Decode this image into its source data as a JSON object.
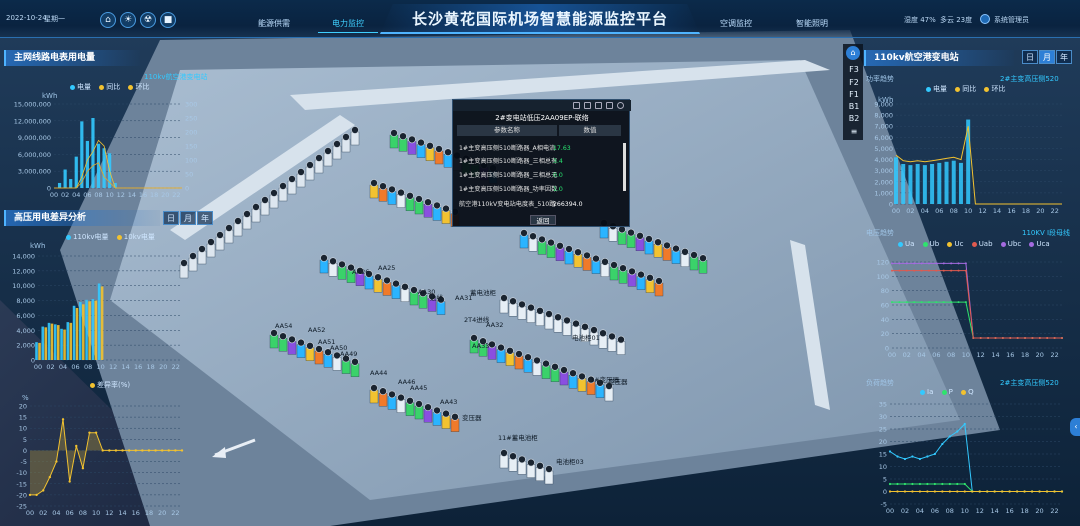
{
  "header": {
    "date": "2022-10-24",
    "weekday": "星期一",
    "title": "长沙黄花国际机场智慧能源监控平台",
    "nav_left": [
      "能源供需",
      "电力监控"
    ],
    "nav_right": [
      "空调监控",
      "智能照明"
    ],
    "weather": "湿度 47%",
    "temperature": "多云 23度",
    "user": "系统管理员",
    "icons": [
      "home-icon",
      "energy-icon",
      "hazard-icon",
      "camera-icon"
    ]
  },
  "left_panels": {
    "main_meter": {
      "title": "主网线路电表用电量",
      "station_label": "110kv航空港变电站",
      "legend": [
        "电量",
        "同比",
        "环比"
      ],
      "y_unit": "kWh",
      "y_left_ticks": [
        "15,000,000",
        "12,000,000",
        "9,000,000",
        "6,000,000",
        "3,000,000",
        "0"
      ],
      "y_right_ticks": [
        "300",
        "250",
        "200",
        "150",
        "100",
        "50",
        "0"
      ],
      "x_ticks": [
        "00",
        "02",
        "04",
        "06",
        "08",
        "10",
        "12",
        "14",
        "16",
        "18",
        "20",
        "22"
      ]
    },
    "hv_diff": {
      "title": "高压用电差异分析",
      "segments": [
        "日",
        "月",
        "年"
      ],
      "active_segment": 0,
      "legend": [
        "110kv电量",
        "10kv电量"
      ],
      "y_unit": "kWh",
      "y_ticks": [
        "14,000",
        "12,000",
        "10,000",
        "8,000",
        "6,000",
        "4,000",
        "2,000",
        "0"
      ],
      "x_ticks": [
        "00",
        "02",
        "04",
        "06",
        "08",
        "10",
        "12",
        "14",
        "16",
        "18",
        "20",
        "22"
      ]
    },
    "diff_rate": {
      "legend": "差异率(%)",
      "y_unit": "%",
      "y_ticks": [
        "20",
        "15",
        "10",
        "5",
        "0",
        "-5",
        "-10",
        "-15",
        "-20",
        "-25"
      ],
      "x_ticks": [
        "00",
        "02",
        "04",
        "06",
        "08",
        "10",
        "12",
        "14",
        "16",
        "18",
        "20",
        "22"
      ]
    }
  },
  "right_panels": {
    "station": {
      "title": "110kv航空港变电站",
      "segments": [
        "日",
        "月",
        "年"
      ],
      "active_segment": 1,
      "floors": [
        "F3",
        "F2",
        "F1",
        "B1",
        "B2"
      ],
      "power_trend": {
        "label": "功率趋势",
        "transformer": "2#主变高压侧520",
        "legend": [
          "电量",
          "同比",
          "环比"
        ],
        "y_unit": "kWh",
        "y_ticks": [
          "9,000",
          "8,000",
          "7,000",
          "6,000",
          "5,000",
          "4,000",
          "3,000",
          "2,000",
          "1,000",
          "0"
        ],
        "x_ticks": [
          "00",
          "02",
          "04",
          "06",
          "08",
          "10",
          "12",
          "14",
          "16",
          "18",
          "20",
          "22"
        ]
      },
      "voltage_trend": {
        "label": "电压趋势",
        "line": "110KV I段母线",
        "legend": [
          "Ua",
          "Ub",
          "Uc",
          "Uab",
          "Ubc",
          "Uca"
        ],
        "y_ticks": [
          "120",
          "100",
          "80",
          "60",
          "40",
          "20",
          "0"
        ],
        "x_ticks": [
          "00",
          "02",
          "04",
          "06",
          "08",
          "10",
          "12",
          "14",
          "16",
          "18",
          "20",
          "22"
        ]
      },
      "load_trend": {
        "label": "负荷趋势",
        "transformer": "2#主变高压侧520",
        "legend": [
          "Ia",
          "P",
          "Q"
        ],
        "y_ticks": [
          "35",
          "30",
          "25",
          "20",
          "15",
          "10",
          "5",
          "0",
          "-5"
        ],
        "x_ticks": [
          "00",
          "02",
          "04",
          "06",
          "08",
          "10",
          "12",
          "14",
          "16",
          "18",
          "20",
          "22"
        ]
      }
    }
  },
  "popup": {
    "title": "2#变电站低压2AA09EP-联络",
    "columns": [
      "参数名称",
      "数值"
    ],
    "rows": [
      {
        "name": "1#主变高压侧510断路器_A相电流",
        "value": "17.63"
      },
      {
        "name": "1#主变高压侧510断路器_三相总有",
        "value": "3.4"
      },
      {
        "name": "1#主变高压侧510断路器_三相总无",
        "value": "0.0"
      },
      {
        "name": "1#主变高压侧510断路器_功率因数",
        "value": "1.0"
      },
      {
        "name": "航空港110kV变电站电度表_510路",
        "value": "266394.0"
      }
    ],
    "back": "返回"
  },
  "scene_labels": [
    "AA31",
    "AA30",
    "AA25",
    "AA26",
    "AA54",
    "AA52",
    "AA51",
    "AA50",
    "AA49",
    "AA44",
    "AA46",
    "AA45",
    "AA43",
    "蓄电池柜",
    "2T4进线",
    "AA32",
    "1#变压器",
    "11#蓄电池柜",
    "电池柜03",
    "电池柜01",
    "AA33",
    "变压器",
    "变压器",
    "进线"
  ],
  "colors": {
    "accent": "#2d7fd6",
    "cyan": "#33c9ff",
    "yellow": "#f2c230",
    "green": "#2fe36d",
    "purple": "#a46be0"
  },
  "chart_data": [
    {
      "type": "bar",
      "title": "主网线路电表用电量",
      "ylabel": "kWh",
      "categories": [
        "00",
        "01",
        "02",
        "03",
        "04",
        "05",
        "06",
        "07",
        "08",
        "09",
        "10",
        "11",
        "12",
        "13",
        "14",
        "15",
        "16",
        "17",
        "18",
        "19",
        "20",
        "21",
        "22",
        "23"
      ],
      "series": [
        {
          "name": "电量",
          "values": [
            0,
            900000,
            3300000,
            1600000,
            5600000,
            11900000,
            8400000,
            12500000,
            7900000,
            7100000,
            6200000,
            900000,
            0,
            0,
            0,
            0,
            0,
            0,
            0,
            0,
            0,
            0,
            0,
            0
          ]
        },
        {
          "name": "同比",
          "values": [
            0,
            0,
            0,
            0,
            0,
            40,
            100,
            130,
            170,
            150,
            60,
            0,
            0,
            0,
            0,
            0,
            0,
            0,
            0,
            0,
            0,
            0,
            0,
            0
          ]
        },
        {
          "name": "环比",
          "values": [
            0,
            0,
            0,
            0,
            0,
            20,
            60,
            80,
            90,
            40,
            20,
            0,
            0,
            0,
            0,
            0,
            0,
            0,
            0,
            0,
            0,
            0,
            0,
            0
          ]
        }
      ],
      "ylim": [
        0,
        15000000
      ],
      "ylim_right": [
        0,
        300
      ]
    },
    {
      "type": "bar",
      "title": "高压用电差异分析",
      "ylabel": "kWh",
      "categories": [
        "00",
        "01",
        "02",
        "03",
        "04",
        "05",
        "06",
        "07",
        "08",
        "09",
        "10",
        "11",
        "12",
        "13",
        "14",
        "15",
        "16",
        "17",
        "18",
        "19",
        "20",
        "21",
        "22",
        "23"
      ],
      "series": [
        {
          "name": "110kv电量",
          "values": [
            2400,
            4500,
            5000,
            4800,
            4200,
            5100,
            7300,
            7800,
            8100,
            8200,
            10300,
            0,
            0,
            0,
            0,
            0,
            0,
            0,
            0,
            0,
            0,
            0,
            0,
            0
          ]
        },
        {
          "name": "10kv电量",
          "values": [
            2300,
            4400,
            4900,
            4700,
            4100,
            5000,
            7000,
            7500,
            7900,
            8000,
            9900,
            0,
            0,
            0,
            0,
            0,
            0,
            0,
            0,
            0,
            0,
            0,
            0,
            0
          ]
        }
      ],
      "ylim": [
        0,
        14000
      ]
    },
    {
      "type": "line",
      "title": "差异率(%)",
      "ylabel": "%",
      "x": [
        0,
        1,
        2,
        3,
        4,
        5,
        6,
        7,
        8,
        9,
        10,
        11,
        12,
        13,
        14,
        15,
        16,
        17,
        18,
        19,
        20,
        21,
        22,
        23
      ],
      "series": [
        {
          "name": "差异率(%)",
          "values": [
            -20,
            -20,
            -18,
            -12,
            -5,
            14,
            -14,
            2,
            -8,
            8,
            8,
            0,
            0,
            0,
            0,
            0,
            0,
            0,
            0,
            0,
            0,
            0,
            0,
            0
          ]
        }
      ],
      "ylim": [
        -25,
        20
      ]
    },
    {
      "type": "bar",
      "title": "功率趋势",
      "ylabel": "kWh",
      "categories": [
        "00",
        "01",
        "02",
        "03",
        "04",
        "05",
        "06",
        "07",
        "08",
        "09",
        "10",
        "11",
        "12",
        "13",
        "14",
        "15",
        "16",
        "17",
        "18",
        "19",
        "20",
        "21",
        "22",
        "23"
      ],
      "series": [
        {
          "name": "电量",
          "values": [
            4200,
            3600,
            3500,
            3600,
            3500,
            3600,
            3700,
            3800,
            3900,
            3700,
            7600,
            0,
            0,
            0,
            0,
            0,
            0,
            0,
            0,
            0,
            0,
            0,
            0,
            0
          ]
        },
        {
          "name": "同比",
          "values": [
            4400,
            3900,
            3800,
            3900,
            3800,
            3900,
            4000,
            4100,
            4200,
            4000,
            7000,
            0,
            0,
            0,
            0,
            0,
            0,
            0,
            0,
            0,
            0,
            0,
            0,
            0
          ]
        }
      ],
      "ylim": [
        0,
        9000
      ]
    },
    {
      "type": "line",
      "title": "电压趋势",
      "x": [
        0,
        1,
        2,
        3,
        4,
        5,
        6,
        7,
        8,
        9,
        10,
        11,
        12,
        13,
        14,
        15,
        16,
        17,
        18,
        19,
        20,
        21,
        22,
        23
      ],
      "series": [
        {
          "name": "Ua",
          "values": [
            118,
            118,
            118,
            118,
            118,
            118,
            118,
            118,
            118,
            118,
            118,
            14,
            14,
            14,
            14,
            14,
            14,
            14,
            14,
            14,
            14,
            14,
            14,
            14
          ]
        },
        {
          "name": "Ub",
          "values": [
            64,
            64,
            64,
            64,
            64,
            64,
            64,
            64,
            64,
            64,
            64,
            14,
            14,
            14,
            14,
            14,
            14,
            14,
            14,
            14,
            14,
            14,
            14,
            14
          ]
        },
        {
          "name": "Uab",
          "values": [
            108,
            108,
            108,
            108,
            108,
            108,
            108,
            108,
            108,
            108,
            108,
            14,
            14,
            14,
            14,
            14,
            14,
            14,
            14,
            14,
            14,
            14,
            14,
            14
          ]
        }
      ],
      "ylim": [
        0,
        120
      ]
    },
    {
      "type": "line",
      "title": "负荷趋势",
      "x": [
        0,
        1,
        2,
        3,
        4,
        5,
        6,
        7,
        8,
        9,
        10,
        11,
        12,
        13,
        14,
        15,
        16,
        17,
        18,
        19,
        20,
        21,
        22,
        23
      ],
      "series": [
        {
          "name": "Ia",
          "values": [
            16,
            14,
            13,
            14,
            13,
            14,
            15,
            19,
            22,
            24,
            27,
            0,
            0,
            0,
            0,
            0,
            0,
            0,
            0,
            0,
            0,
            0,
            0,
            0
          ]
        },
        {
          "name": "P",
          "values": [
            3,
            3,
            3,
            3,
            3,
            3,
            3,
            3,
            3,
            3,
            3,
            0,
            0,
            0,
            0,
            0,
            0,
            0,
            0,
            0,
            0,
            0,
            0,
            0
          ]
        },
        {
          "name": "Q",
          "values": [
            0,
            0,
            0,
            0,
            0,
            0,
            0,
            0,
            0,
            0,
            0,
            0,
            0,
            0,
            0,
            0,
            0,
            0,
            0,
            0,
            0,
            0,
            0,
            0
          ]
        }
      ],
      "ylim": [
        -5,
        35
      ]
    }
  ]
}
